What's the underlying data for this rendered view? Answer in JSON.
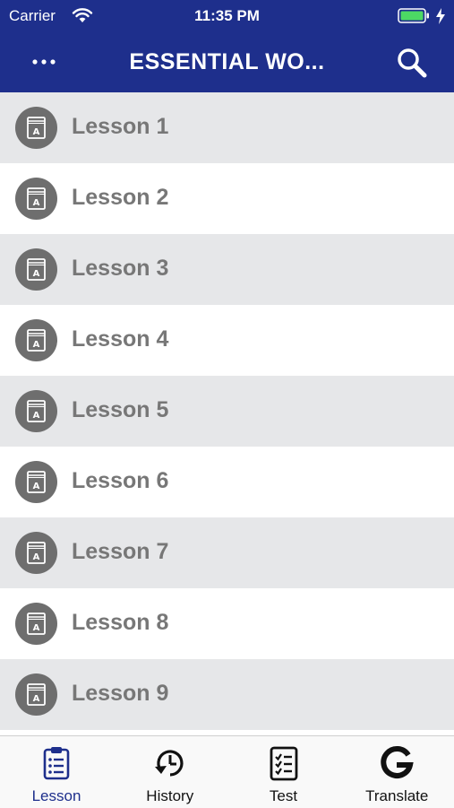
{
  "status_bar": {
    "carrier": "Carrier",
    "time": "11:35 PM"
  },
  "nav": {
    "title": "ESSENTIAL WO..."
  },
  "lessons": [
    {
      "label": "Lesson 1"
    },
    {
      "label": "Lesson 2"
    },
    {
      "label": "Lesson 3"
    },
    {
      "label": "Lesson 4"
    },
    {
      "label": "Lesson 5"
    },
    {
      "label": "Lesson 6"
    },
    {
      "label": "Lesson 7"
    },
    {
      "label": "Lesson 8"
    },
    {
      "label": "Lesson 9"
    }
  ],
  "tabs": [
    {
      "label": "Lesson",
      "icon": "clipboard-list-icon",
      "active": true
    },
    {
      "label": "History",
      "icon": "history-icon",
      "active": false
    },
    {
      "label": "Test",
      "icon": "checklist-icon",
      "active": false
    },
    {
      "label": "Translate",
      "icon": "google-g-icon",
      "active": false
    }
  ],
  "colors": {
    "header": "#1e2f8c",
    "row_alt": "#e6e7e9",
    "label": "#777777",
    "active_tab": "#1e2f8c"
  }
}
